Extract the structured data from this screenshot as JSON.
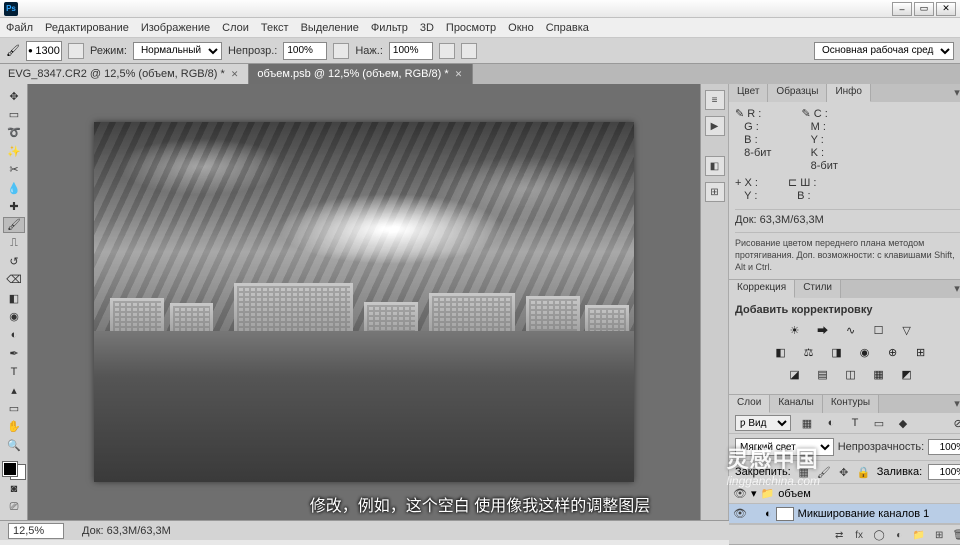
{
  "window": {
    "logo": "Ps"
  },
  "menu": [
    "Файл",
    "Редактирование",
    "Изображение",
    "Слои",
    "Текст",
    "Выделение",
    "Фильтр",
    "3D",
    "Просмотр",
    "Окно",
    "Справка"
  ],
  "workspace_selector": "Основная рабочая среда",
  "options": {
    "brush_size": "1300",
    "mode_label": "Режим:",
    "mode_value": "Нормальный",
    "opacity_label": "Непрозр.:",
    "opacity_value": "100%",
    "flow_label": "Наж.:",
    "flow_value": "100%"
  },
  "doc_tabs": [
    {
      "title": "EVG_8347.CR2 @ 12,5% (объем, RGB/8) *"
    },
    {
      "title": "объем.psb @ 12,5% (объем, RGB/8) *"
    }
  ],
  "status": {
    "zoom": "12,5%",
    "doc": "Док: 63,3M/63,3M"
  },
  "panels": {
    "info": {
      "tabs": [
        "Цвет",
        "Образцы",
        "Инфо"
      ],
      "rgb": {
        "r_label": "R :",
        "g_label": "G :",
        "b_label": "B :"
      },
      "cmyk": {
        "c_label": "C :",
        "m_label": "M :",
        "y_label": "Y :",
        "k_label": "K :"
      },
      "bit1": "8-бит",
      "bit2": "8-бит",
      "xy": {
        "x_label": "X :",
        "y_label": "Y :"
      },
      "wh": {
        "w_label": "Ш :",
        "h_label": "В :"
      },
      "doc": "Док: 63,3M/63,3M",
      "hint": "Рисование цветом переднего плана методом протягивания. Доп. возможности: с клавишами Shift, Alt и Ctrl."
    },
    "adjust": {
      "tabs": [
        "Коррекция",
        "Стили"
      ],
      "heading": "Добавить корректировку"
    },
    "layers": {
      "tabs": [
        "Слои",
        "Каналы",
        "Контуры"
      ],
      "kind_label": "ƿ Вид",
      "blend_mode": "Мягкий свет",
      "opacity_label": "Непрозрачность:",
      "opacity_value": "100%",
      "lock_label": "Закрепить:",
      "fill_label": "Заливка:",
      "fill_value": "100%",
      "items": [
        {
          "name": "объем"
        },
        {
          "name": "Микширование каналов 1"
        }
      ]
    }
  },
  "subtitle": "修改，例如，这个空白 使用像我这样的调整图层",
  "watermark": {
    "line1": "灵感中国",
    "line2": "lingganchina.com"
  }
}
